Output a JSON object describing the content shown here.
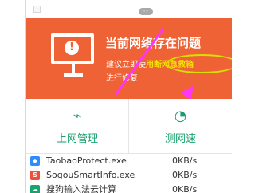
{
  "titlebar": {
    "gamepad_icon": "gamepad-icon"
  },
  "status": {
    "title": "当前网络存在问题",
    "suggestion_prefix": "建议立即使",
    "rescue_text": "用断网急救箱",
    "suggestion_suffix": "进行修复"
  },
  "actions": [
    {
      "label": "上网管理",
      "icon": "trend-chart-icon"
    },
    {
      "label": "测网速",
      "icon": "speedometer-icon"
    }
  ],
  "processes": [
    {
      "name": "TaobaoProtect.exe",
      "speed": "0KB/s",
      "icon": "shield-icon"
    },
    {
      "name": "SogouSmartInfo.exe",
      "speed": "0KB/s",
      "icon": "sogou-icon"
    },
    {
      "name": "搜狗输入法云计算",
      "speed": "0KB/s",
      "icon": "cloud-icon"
    }
  ],
  "colors": {
    "banner": "#ef6236",
    "accent": "#19a36f",
    "highlight": "#f6e200",
    "arrow": "#ff35f7"
  }
}
